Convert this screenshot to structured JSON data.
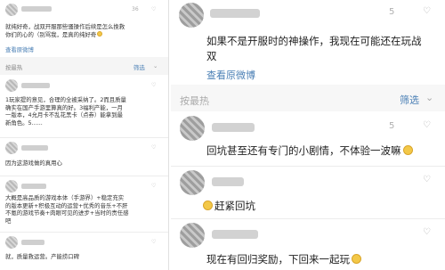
{
  "left": {
    "top_comment": {
      "time": "36",
      "lines": [
        "就纯好奇，战双开服那些骚操作后续是怎么挽救",
        "你们的心的（别骂我，是真的纯好奇"
      ],
      "view_link": "查看原微博"
    },
    "section": {
      "label": "按最热",
      "filter": "筛选",
      "chevron": "⌄"
    },
    "comments": [
      {
        "lines": [
          "1玩家提的意见，合理的全被采纳了。2而且质量",
          "确实在国产手游里算真的好。3福利产能，一月",
          "一版本，4允月卡不乱花黑卡（点券）能拿到最",
          "新角色。5......"
        ]
      },
      {
        "lines": [
          "因为这游戏做的真用心"
        ]
      },
      {
        "lines": [
          "大概是高品质的游戏本体（手游界）+稳定充实",
          "的版本更新+积极互动的运营+优秀的音乐+不肝",
          "不氪的游戏节奏+肉眼可见的进步+当时的责任感",
          "吧"
        ]
      },
      {
        "lines": [
          "就，质量救运营。产能捞口碑"
        ]
      }
    ]
  },
  "right": {
    "top_comment": {
      "time": "5",
      "lines": [
        "如果不是开服时的神操作，我现在可能还在玩战",
        "双"
      ],
      "view_link": "查看原微博"
    },
    "section": {
      "label": "按最热",
      "filter": "筛选",
      "chevron": "⌄"
    },
    "comments": [
      {
        "time": "5",
        "text": "回坑甚至还有专门的小剧情，不体验一波嘛"
      },
      {
        "time": "",
        "text": "赶紧回坑"
      },
      {
        "time": "",
        "text": "现在有回归奖励，下回来一起玩"
      }
    ]
  },
  "colors": {
    "link": "#4a7fb5",
    "emoji": "#f3c848",
    "background": "#f5f5f5"
  },
  "icons": [
    "avatar-blurred",
    "emoji-grin-icon",
    "chevron-down-icon"
  ]
}
